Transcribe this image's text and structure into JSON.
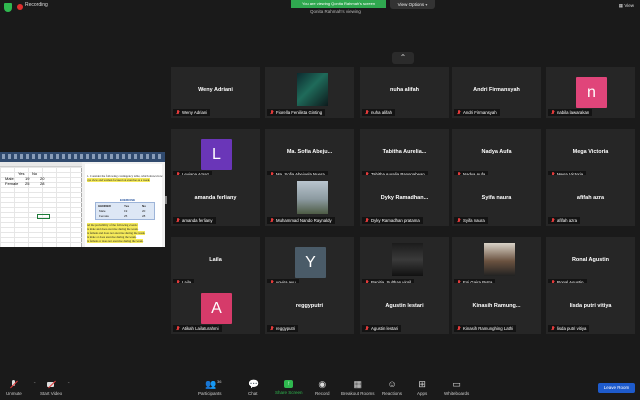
{
  "top_bar": {
    "recording_label": "Recording",
    "share_banner": "You are viewing Qonita Rahmah's screen",
    "view_options_label": "View Options",
    "view_label": "View",
    "viewing_label": "Qonita Rahmah's viewing"
  },
  "gallery": {
    "tiles": [
      {
        "big_name": "Weny Adriani",
        "label": "Weny Adriani"
      },
      {
        "big_name": "",
        "label": "Fiorella Fenilista Ginting"
      },
      {
        "big_name": "nuha alifah",
        "label": "nuha alifah"
      },
      {
        "big_name": "Andri Firmansyah",
        "label": "Andri Firmansyah"
      },
      {
        "big_name": "",
        "label": "nabila lawarakan",
        "avatar": "n",
        "avatar_color": "#e0457a"
      },
      {
        "big_name": "",
        "label": "Leviana Azrez",
        "avatar": "L",
        "avatar_color": "#6a36b8"
      },
      {
        "big_name": "Ma. Sofia Abeju...",
        "label": "Ma_Sofia Abejuela Nuera"
      },
      {
        "big_name": "Tabitha Aurelia...",
        "label": "Tabitha Aurelia Panggabean"
      },
      {
        "big_name": "Nadya Aufa",
        "label": "Nadya Aufa"
      },
      {
        "big_name": "Mega Victoria",
        "label": "Mega Victoria"
      },
      {
        "big_name": "amanda ferliany",
        "label": "amanda ferliany"
      },
      {
        "big_name": "",
        "label": "Muhammad Nando Raynaldy"
      },
      {
        "big_name": "Dyky Ramadhan...",
        "label": "Dyky Ramadhan pratama"
      },
      {
        "big_name": "Syifa naura",
        "label": "Syifa naura"
      },
      {
        "big_name": "afifah azra",
        "label": "afifah azra"
      },
      {
        "big_name": "Laila",
        "label": "Laila"
      },
      {
        "big_name": "",
        "label": "yovira ayu",
        "avatar": "Y",
        "avatar_color": "#4a5b68"
      },
      {
        "big_name": "",
        "label": "Panitia_Sulthan virgil"
      },
      {
        "big_name": "",
        "label": "Egi Gaira Putra"
      },
      {
        "big_name": "Ronal Agustin",
        "label": "Ronal Agustin"
      },
      {
        "big_name": "",
        "label": "Atikah Lailaturahmi",
        "avatar": "A",
        "avatar_color": "#d63b6a"
      },
      {
        "big_name": "reggyputri",
        "label": "reggyputri"
      },
      {
        "big_name": "Agustin lestari",
        "label": "Agustin lestari"
      },
      {
        "big_name": "Kinasih Ramung...",
        "label": "Kinasih Ramunghing Lathi"
      },
      {
        "big_name": "lisda putri vitiya",
        "label": "lisda putri vitiya"
      }
    ]
  },
  "shared_screen": {
    "excel": {
      "col_headers": [
        "",
        "A",
        "B",
        "C",
        "D"
      ],
      "row_headers": [
        "1",
        "2",
        "3",
        "4",
        "5",
        "6",
        "7",
        "8",
        "9",
        "10",
        "11",
        "12",
        "13",
        "14",
        "15"
      ],
      "header_yes": "Yes",
      "header_no": "No",
      "row1_label": "Male",
      "row1_yes": "19",
      "row1_no": "20",
      "row2_label": "Female",
      "row2_yes": "25",
      "row2_no": "28"
    },
    "doc": {
      "line1": "1. Consider the following contingency table, which shows how",
      "line2": "oys view and women focused on exercise as a week.",
      "heading": "EXERCISE",
      "table_head": [
        "GENDER",
        "Yes",
        "No"
      ],
      "table_row1": [
        "Male",
        "19",
        "20"
      ],
      "table_row2": [
        "Female",
        "25",
        "28"
      ],
      "hl1": "nd the probability of the following events:",
      "hl2": "is male and does exercise during the week.",
      "hl3": "is female and does not exercise during the week.",
      "hl4": "is male or does exercise during the week.",
      "hl5": "is female or does not exercise during the week."
    }
  },
  "toolbar": {
    "unmute": "Unmute",
    "start_video": "Start Video",
    "participants": "Participants",
    "participants_count": "36",
    "chat": "Chat",
    "share_screen": "Share Screen",
    "record": "Record",
    "breakout_rooms": "Breakout Rooms",
    "reactions": "Reactions",
    "apps": "Apps",
    "whiteboards": "Whiteboards",
    "leave_room": "Leave Room"
  }
}
